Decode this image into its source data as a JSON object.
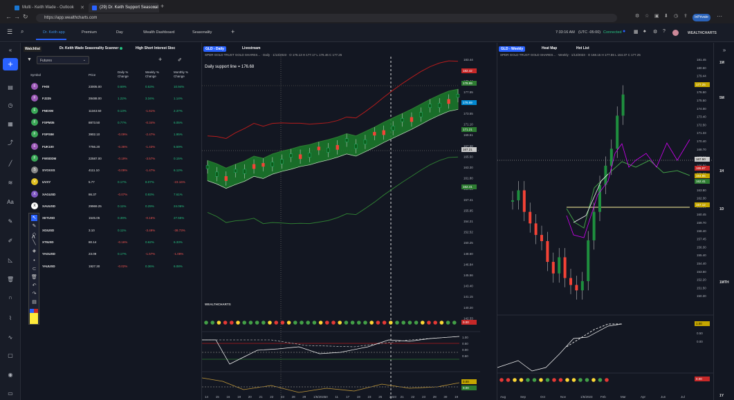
{
  "browser": {
    "tabs": [
      {
        "label": "Multi - Keith Wade - Outlook"
      },
      {
        "label": "(29) Dr. Keith Support Seasonal"
      }
    ],
    "url": "https://app.wealthcharts.com",
    "inprivate": "InPrivate"
  },
  "topnav": {
    "items": [
      {
        "label": "Dr. Keith app"
      },
      {
        "label": "Premium"
      },
      {
        "label": "Day"
      },
      {
        "label": "Wealth Dashboard"
      },
      {
        "label": "Seasonality"
      }
    ],
    "plus": "+",
    "clock": "7:33:16 AM",
    "timezone": "(UTC -05:00)",
    "status": "Connected",
    "brand": "WEALTHCHARTS"
  },
  "watchlist": {
    "tabs": [
      {
        "label": "Watchlist"
      },
      {
        "label": "Dr. Keith Wade Seasonality Scanner"
      },
      {
        "label": "High Short Interest Stoc"
      }
    ],
    "select": "Futures",
    "headers": {
      "symbol": "Symbol",
      "price": "Price",
      "daily": "Daily % Change",
      "weekly": "Weekly % Change",
      "monthly": "Monthly % Change"
    },
    "rows": [
      {
        "icon": "F",
        "color": "#9b59b6",
        "symbol": "FHSI",
        "price": "23005.00",
        "daily": "0.69%",
        "weekly": "0.53%",
        "monthly": "10.94%"
      },
      {
        "icon": "F",
        "color": "#9b59b6",
        "symbol": "FJ225",
        "price": "28488.00",
        "daily": "1.22%",
        "weekly": "3.34%",
        "monthly": "1.14%"
      },
      {
        "icon": "F",
        "color": "#3aa857",
        "symbol": "FNDXM",
        "price": "11343.50",
        "daily": "0.13%",
        "weekly": "-1.61%",
        "monthly": "2.37%"
      },
      {
        "icon": "F",
        "color": "#3aa857",
        "symbol": "FSPM35",
        "price": "8873.50",
        "daily": "0.77%",
        "weekly": "-0.34%",
        "monthly": "6.05%"
      },
      {
        "icon": "F",
        "color": "#3aa857",
        "symbol": "FSPSIM",
        "price": "3902.10",
        "daily": "-0.09%",
        "weekly": "-2.47%",
        "monthly": "1.95%"
      },
      {
        "icon": "F",
        "color": "#9b59b6",
        "symbol": "FUK100",
        "price": "7756.20",
        "daily": "-0.36%",
        "weekly": "-1.43%",
        "monthly": "5.59%"
      },
      {
        "icon": "F",
        "color": "#3aa857",
        "symbol": "FWSDDM",
        "price": "22587.00",
        "daily": "-0.19%",
        "weekly": "-3.57%",
        "monthly": "0.15%"
      },
      {
        "icon": "S",
        "color": "#888888",
        "symbol": "SYOXXS",
        "price": "4111.10",
        "daily": "-0.09%",
        "weekly": "-1.47%",
        "monthly": "6.12%"
      },
      {
        "icon": "V",
        "color": "#e0c020",
        "symbol": "UVXY",
        "price": "5.77",
        "daily": "0.17%",
        "weekly": "8.07%",
        "monthly": "-23.16%"
      },
      {
        "icon": "X",
        "color": "#7e57c2",
        "symbol": "XAGUSD",
        "price": "86.37",
        "daily": "-0.07%",
        "weekly": "0.93%",
        "monthly": "7.61%"
      },
      {
        "icon": "X",
        "color": "#ffffff",
        "symbol": "XAUUSD",
        "price": "29969.25",
        "daily": "0.11%",
        "weekly": "0.29%",
        "monthly": "24.06%"
      },
      {
        "icon": "X",
        "color": "#29b6f6",
        "symbol": "XETUSD",
        "price": "1545.05",
        "daily": "0.39%",
        "weekly": "-0.16%",
        "monthly": "27.55%"
      },
      {
        "icon": "X",
        "color": "#7e57c2",
        "symbol": "XGIUSD",
        "price": "3.10",
        "daily": "0.11%",
        "weekly": "-3.49%",
        "monthly": "-38.73%"
      },
      {
        "icon": "X",
        "color": "#7e57c2",
        "symbol": "XTIUSD",
        "price": "80.14",
        "daily": "-0.16%",
        "weekly": "0.62%",
        "monthly": "6.33%"
      },
      {
        "icon": "Y",
        "color": "#888888",
        "symbol": "YAGUSD",
        "price": "23.09",
        "daily": "0.17%",
        "weekly": "-1.57%",
        "monthly": "-1.08%"
      },
      {
        "icon": "Y",
        "color": "#888888",
        "symbol": "YAUUSD",
        "price": "1927.30",
        "daily": "-0.02%",
        "weekly": "0.36%",
        "monthly": "6.08%"
      }
    ]
  },
  "mid": {
    "tabs": [
      {
        "label": "GLD - Daily"
      },
      {
        "label": "Livestream"
      }
    ],
    "subtitle": "SPDR GOLD TRUST GOLD SHARES... · Daily · 1/13/2023 · O 176.13 H 177.17 L 176.46 C 177.25",
    "annotation": "Daily support line = 176.68",
    "yaxis": [
      "183.44",
      "181.44",
      "179.44",
      "177.55",
      "175.00",
      "173.55",
      "171.10",
      "169.51",
      "167.58",
      "165.50",
      "163.30",
      "161.80",
      "159.05",
      "157.41",
      "155.95",
      "154.21",
      "152.52",
      "150.25",
      "148.60",
      "146.84",
      "145.56",
      "143.40",
      "141.15",
      "140.20",
      "142.33"
    ],
    "tags": [
      {
        "v": "182.42",
        "c": "#c62828"
      },
      {
        "v": "178.89",
        "c": "#2e7d32"
      },
      {
        "v": "176.69",
        "c": "#0288d1"
      },
      {
        "v": "171.21",
        "c": "#2e7d32"
      },
      {
        "v": "167.21",
        "c": "#cccccc"
      },
      {
        "v": "162.41",
        "c": "#2e7d32"
      }
    ],
    "xaxis": [
      "14",
      "15",
      "16",
      "19",
      "20",
      "21",
      "22",
      "23",
      "28",
      "29",
      "1/6/2023",
      "10",
      "11",
      "17",
      "19",
      "23",
      "25",
      "2023",
      "21",
      "22",
      "23",
      "28",
      "30",
      "19"
    ],
    "logo": "WEALTHCHARTS",
    "ind1": "0.00",
    "ind2": [
      "1.00",
      "0.50",
      "0.00",
      "0.50"
    ],
    "ind3": [
      "0.00",
      "0.00"
    ]
  },
  "right": {
    "tabs": [
      {
        "label": "GLD - Weekly"
      },
      {
        "label": "Heat Map"
      },
      {
        "label": "Hot List"
      }
    ],
    "subtitle": "SPDR GOLD TRUST GOLD SHARES... · Weekly · 1/13/2023 · O 168.15 H 177.55 L 164.37 C 177.25",
    "yaxis": [
      "181.45",
      "180.50",
      "179.44",
      "177.55",
      "176.50",
      "175.50",
      "174.00",
      "173.40",
      "172.50",
      "171.33",
      "170.40",
      "168.70",
      "167.82",
      "166.50",
      "165.50",
      "164.70",
      "163.80",
      "162.30",
      "161.50",
      "160.45",
      "159.70",
      "158.40",
      "157.45",
      "156.30",
      "155.40",
      "154.40",
      "153.50",
      "152.20",
      "151.50",
      "150.30"
    ],
    "tags": [
      {
        "v": "177.25",
        "c": "#c6a700"
      },
      {
        "v": "167.50",
        "c": "#cccccc"
      },
      {
        "v": "165.87",
        "c": "#c62828"
      },
      {
        "v": "164.85",
        "c": "#c6a700"
      },
      {
        "v": "162.41",
        "c": "#2e7d32"
      },
      {
        "v": "157.12",
        "c": "#c6a700"
      }
    ],
    "xaxis": [
      "Aug",
      "Sep",
      "Oct",
      "Nov",
      "1/6/2023",
      "Feb",
      "Mar",
      "Apr",
      "Jun",
      "Jul"
    ],
    "ind1": [
      "1.00",
      "0.50",
      "0.00"
    ],
    "ind2": "0.00"
  },
  "timeframes": [
    "1M",
    "5M",
    "1H",
    "1D",
    "1MTH",
    "1Y"
  ],
  "chart_data": [
    {
      "type": "candlestick",
      "name": "GLD - Daily",
      "ylim": [
        140.2,
        183.44
      ],
      "points": [
        164.2,
        163.6,
        162.8,
        163.5,
        164.1,
        165.0,
        164.6,
        165.4,
        165.9,
        166.3,
        166.8,
        167.1,
        167.6,
        168.0,
        168.5,
        169.1,
        168.7,
        169.5,
        170.3,
        171.2,
        172.0,
        172.8,
        173.6,
        174.5,
        175.4,
        176.2,
        176.9,
        177.25
      ]
    },
    {
      "type": "candlestick",
      "name": "GLD - Weekly",
      "ylim": [
        150.3,
        181.45
      ],
      "points": [
        163.5,
        164.8,
        162.0,
        160.5,
        159.0,
        158.2,
        155.5,
        154.0,
        156.1,
        153.4,
        152.5,
        151.8,
        153.0,
        158.3,
        162.0,
        165.5,
        168.0,
        170.2,
        174.5,
        177.25
      ]
    }
  ]
}
